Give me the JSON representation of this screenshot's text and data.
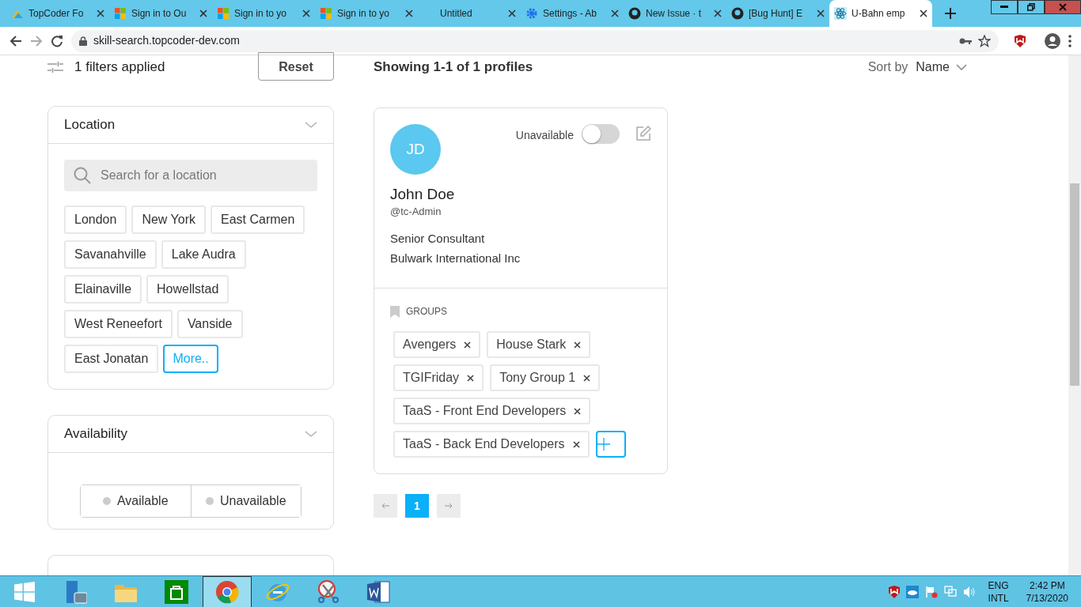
{
  "browser": {
    "tabs": [
      {
        "title": "TopCoder Fo",
        "kind": "topcoder",
        "selected": false
      },
      {
        "title": "Sign in to Ou",
        "kind": "microsoft",
        "selected": false
      },
      {
        "title": "Sign in to yo",
        "kind": "microsoft",
        "selected": false
      },
      {
        "title": "Sign in to yo",
        "kind": "microsoft",
        "selected": false
      },
      {
        "title": "Untitled",
        "kind": "blank",
        "selected": false
      },
      {
        "title": "Settings - Ab",
        "kind": "gear",
        "selected": false
      },
      {
        "title": "New Issue · t",
        "kind": "github",
        "selected": false
      },
      {
        "title": "[Bug Hunt] E",
        "kind": "github",
        "selected": false
      },
      {
        "title": "U-Bahn emp",
        "kind": "react",
        "selected": true
      }
    ],
    "url": "skill-search.topcoder-dev.com"
  },
  "filters": {
    "summary": "1 filters applied",
    "reset": "Reset"
  },
  "location": {
    "title": "Location",
    "placeholder": "Search for a location",
    "tags": [
      "London",
      "New York",
      "East Carmen",
      "Savanahville",
      "Lake Audra",
      "Elainaville",
      "Howellstad",
      "West Reneefort",
      "Vanside",
      "East Jonatan"
    ],
    "more": "More.."
  },
  "availability": {
    "title": "Availability",
    "options": [
      {
        "label": "Available",
        "selected": false
      },
      {
        "label": "Unavailable",
        "selected": false
      }
    ]
  },
  "results": {
    "summary": "Showing 1-1 of 1 profiles",
    "sort_label": "Sort by",
    "sort_value": "Name"
  },
  "profiles": [
    {
      "initials": "JD",
      "name": "John Doe",
      "handle": "@tc-Admin",
      "title": "Senior Consultant",
      "company": "Bulwark International Inc",
      "availability_label": "Unavailable",
      "available": false,
      "groups_label": "GROUPS",
      "groups": [
        "Avengers",
        "House Stark",
        "TGIFriday",
        "Tony Group 1",
        "TaaS - Front End Developers",
        "TaaS - Back End Developers"
      ]
    }
  ],
  "pagination": {
    "pages": [
      {
        "label": "1",
        "selected": true
      }
    ]
  },
  "taskbar": {
    "apps": [
      {
        "kind": "server",
        "selected": false
      },
      {
        "kind": "folder",
        "selected": false
      },
      {
        "kind": "store",
        "selected": false
      },
      {
        "kind": "chrome",
        "selected": true
      },
      {
        "kind": "ie",
        "selected": false
      },
      {
        "kind": "scissors",
        "selected": false
      },
      {
        "kind": "word",
        "selected": false
      }
    ],
    "language": "ENG",
    "layout": "INTL",
    "time": "2:42 PM",
    "date": "7/13/2020"
  }
}
